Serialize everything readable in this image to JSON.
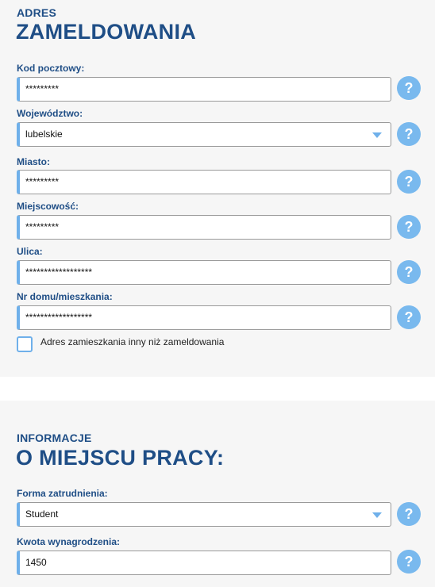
{
  "address_section": {
    "subtitle": "ADRES",
    "title": "ZAMELDOWANIA",
    "fields": [
      {
        "label": "Kod pocztowy:",
        "value": "*********"
      },
      {
        "label": "Województwo:",
        "value": "lubelskie"
      },
      {
        "label": "Miasto:",
        "value": "*********"
      },
      {
        "label": "Miejscowość:",
        "value": "*********"
      },
      {
        "label": "Ulica:",
        "value": "******************"
      },
      {
        "label": "Nr domu/mieszkania:",
        "value": "******************"
      }
    ],
    "checkbox_label": "Adres zamieszkania inny niż zameldowania"
  },
  "work_section": {
    "subtitle": "INFORMACJE",
    "title": "O MIEJSCU PRACY:",
    "fields": [
      {
        "label": "Forma zatrudnienia:",
        "value": "Student"
      },
      {
        "label": "Kwota wynagrodzenia:",
        "value": "1450"
      }
    ]
  },
  "help_symbol": "?",
  "icons": {
    "help": "question-circle-icon",
    "select_arrow": "chevron-down-icon"
  },
  "colors": {
    "heading": "#1f4e86",
    "accent": "#6fb0ea",
    "help_button": "#79b9ee",
    "panel_bg": "#f6f6f6"
  }
}
